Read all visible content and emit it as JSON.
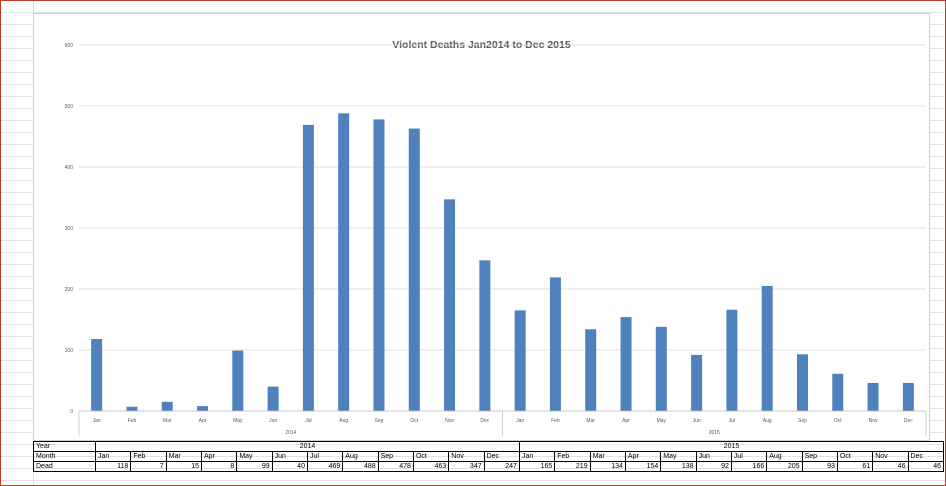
{
  "chart_data": {
    "type": "bar",
    "title": "Violent Deaths Jan2014 to Dec 2015",
    "ylim": [
      0,
      600
    ],
    "yticks": [
      0,
      100,
      200,
      300,
      400,
      500,
      600
    ],
    "grid": true,
    "color": "#4f81bd",
    "categories": [
      "Jan",
      "Feb",
      "Mar",
      "Apr",
      "May",
      "Jun",
      "Jul",
      "Aug",
      "Sep",
      "Oct",
      "Nov",
      "Dec",
      "Jan",
      "Feb",
      "Mar",
      "Apr",
      "May",
      "Jun",
      "Jul",
      "Aug",
      "Sep",
      "Oct",
      "Nov",
      "Dec"
    ],
    "groups": [
      {
        "label": "2014",
        "count": 12
      },
      {
        "label": "2015",
        "count": 12
      }
    ],
    "series": [
      {
        "name": "Dead",
        "values": [
          118,
          7,
          15,
          8,
          99,
          40,
          469,
          488,
          478,
          463,
          347,
          247,
          165,
          219,
          134,
          154,
          138,
          92,
          166,
          205,
          93,
          61,
          46,
          46
        ]
      }
    ]
  },
  "table": {
    "year_label": "Year",
    "month_label": "Month",
    "dead_label": "Dead"
  }
}
